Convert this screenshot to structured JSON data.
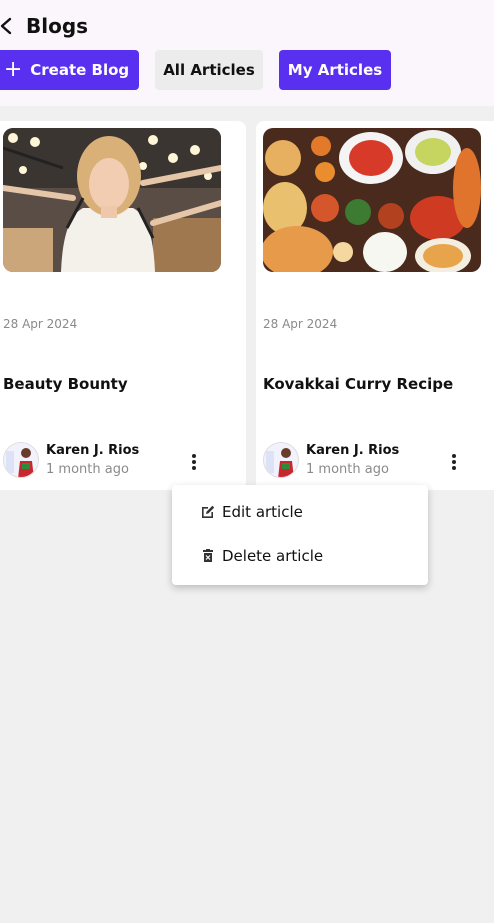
{
  "header": {
    "title": "Blogs",
    "create_label": "Create Blog",
    "all_label": "All Articles",
    "mine_label": "My Articles"
  },
  "cards": [
    {
      "date": "28 Apr 2024",
      "title": "Beauty Bounty",
      "author": "Karen J. Rios",
      "ago": "1 month ago"
    },
    {
      "date": "28 Apr 2024",
      "title": "Kovakkai Curry Recipe",
      "author": "Karen J. Rios",
      "ago": "1 month ago"
    }
  ],
  "menu": {
    "edit_label": "Edit article",
    "delete_label": "Delete article"
  },
  "colors": {
    "accent": "#5a30f0",
    "header_bg": "#fbf6fc",
    "page_bg": "#f0f0f0"
  }
}
